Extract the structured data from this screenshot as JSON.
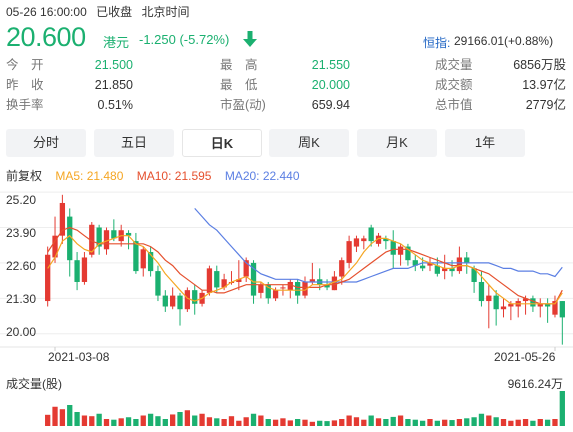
{
  "header": {
    "datetime": "05-26 16:00:00",
    "status": "已收盘",
    "timezone": "北京时间"
  },
  "quote": {
    "price": "20.600",
    "currency": "港元",
    "change": "-1.250 (-5.72%)",
    "index_label": "恒指:",
    "index_value": "29166.01(+0.88%)"
  },
  "stats": {
    "open_label": "今　开",
    "open": "21.500",
    "prev_label": "昨　收",
    "prev": "21.850",
    "turnover_label": "换手率",
    "turnover": "0.51%",
    "high_label": "最　高",
    "high": "21.550",
    "low_label": "最　低",
    "low": "20.000",
    "pe_label": "市盈(动)",
    "pe": "659.94",
    "volume_label": "成交量",
    "volume": "6856万股",
    "amount_label": "成交额",
    "amount": "13.97亿",
    "mcap_label": "总市值",
    "mcap": "2779亿"
  },
  "tabs": [
    "分时",
    "五日",
    "日K",
    "周K",
    "月K",
    "1年"
  ],
  "active_tab": "日K",
  "ma": {
    "adjust": "前复权",
    "ma5": "MA5: 21.480",
    "ma10": "MA10: 21.595",
    "ma20": "MA20: 22.440"
  },
  "colors": {
    "up": "#e43a32",
    "down": "#1bb070",
    "ma5": "#f5a623",
    "ma10": "#e5502e",
    "ma20": "#5b7fe3",
    "index": "#2166c4"
  },
  "chart_data": {
    "type": "candlestick",
    "y_ticks": [
      "25.20",
      "23.90",
      "22.60",
      "21.30",
      "20.00"
    ],
    "ylim": [
      19.55,
      25.35
    ],
    "x_start_label": "2021-03-08",
    "x_end_label": "2021-05-26",
    "volume_label": "成交量(股)",
    "volume_max_label": "9616.24万",
    "candles": [
      [
        21.2,
        22.9,
        23.2,
        21.0
      ],
      [
        22.8,
        23.6,
        24.3,
        22.6
      ],
      [
        23.6,
        24.8,
        25.1,
        23.3
      ],
      [
        24.3,
        22.7,
        24.6,
        22.1
      ],
      [
        22.7,
        21.9,
        23.0,
        21.6
      ],
      [
        21.9,
        22.8,
        23.0,
        21.8
      ],
      [
        22.9,
        24.0,
        24.1,
        22.8
      ],
      [
        23.9,
        23.2,
        24.0,
        22.9
      ],
      [
        23.1,
        23.8,
        23.9,
        22.9
      ],
      [
        23.8,
        23.5,
        24.2,
        23.4
      ],
      [
        23.4,
        23.8,
        24.0,
        23.2
      ],
      [
        23.7,
        23.6,
        23.8,
        23.1
      ],
      [
        23.4,
        22.3,
        23.7,
        22.2
      ],
      [
        22.4,
        23.1,
        23.2,
        22.1
      ],
      [
        23.0,
        22.3,
        23.2,
        22.1
      ],
      [
        22.3,
        21.4,
        22.5,
        21.2
      ],
      [
        21.4,
        21.0,
        21.6,
        20.8
      ],
      [
        21.0,
        21.4,
        21.7,
        20.9
      ],
      [
        21.4,
        20.9,
        21.5,
        20.3
      ],
      [
        20.9,
        21.6,
        21.7,
        20.8
      ],
      [
        21.6,
        21.1,
        21.8,
        20.7
      ],
      [
        21.1,
        21.5,
        21.6,
        21.0
      ],
      [
        21.5,
        22.4,
        22.5,
        21.4
      ],
      [
        22.3,
        21.7,
        22.5,
        21.5
      ],
      [
        21.7,
        22.0,
        22.2,
        21.6
      ],
      [
        21.9,
        21.9,
        22.3,
        21.8
      ],
      [
        21.9,
        22.0,
        22.7,
        21.6
      ],
      [
        22.1,
        22.7,
        22.8,
        21.9
      ],
      [
        22.6,
        21.4,
        22.7,
        21.1
      ],
      [
        21.5,
        21.8,
        21.9,
        21.3
      ],
      [
        21.8,
        21.3,
        21.9,
        21.1
      ],
      [
        21.3,
        21.6,
        21.7,
        21.2
      ],
      [
        21.7,
        21.7,
        21.8,
        21.4
      ],
      [
        21.6,
        21.9,
        22.0,
        21.3
      ],
      [
        21.9,
        21.4,
        22.0,
        21.1
      ],
      [
        21.4,
        21.9,
        22.1,
        21.3
      ],
      [
        21.9,
        22.0,
        22.6,
        21.8
      ],
      [
        22.0,
        21.8,
        22.4,
        21.6
      ],
      [
        21.8,
        21.7,
        22.0,
        21.6
      ],
      [
        21.6,
        22.1,
        22.3,
        21.6
      ],
      [
        22.1,
        22.7,
        22.8,
        21.8
      ],
      [
        22.6,
        23.4,
        23.6,
        22.4
      ],
      [
        23.2,
        23.5,
        23.6,
        23.0
      ],
      [
        23.4,
        23.5,
        23.6,
        23.1
      ],
      [
        23.9,
        23.4,
        24.0,
        23.2
      ],
      [
        23.3,
        23.6,
        23.7,
        23.2
      ],
      [
        23.5,
        23.4,
        23.6,
        23.1
      ],
      [
        23.4,
        22.9,
        23.8,
        22.4
      ],
      [
        22.9,
        23.2,
        23.3,
        22.5
      ],
      [
        23.2,
        22.7,
        23.3,
        22.5
      ],
      [
        22.7,
        22.5,
        22.9,
        22.3
      ],
      [
        22.5,
        22.4,
        22.8,
        22.3
      ],
      [
        22.5,
        22.6,
        22.8,
        22.3
      ],
      [
        22.5,
        22.2,
        22.8,
        22.1
      ],
      [
        22.3,
        22.4,
        22.9,
        22.0
      ],
      [
        22.4,
        22.3,
        22.7,
        22.1
      ],
      [
        22.3,
        22.8,
        23.2,
        22.2
      ],
      [
        22.8,
        22.6,
        23.0,
        22.2
      ],
      [
        22.4,
        21.9,
        22.5,
        21.5
      ],
      [
        21.9,
        21.2,
        22.3,
        21.0
      ],
      [
        21.2,
        21.4,
        21.8,
        20.2
      ],
      [
        21.4,
        20.9,
        21.6,
        20.3
      ],
      [
        20.9,
        21.0,
        21.3,
        20.6
      ],
      [
        21.0,
        21.1,
        21.2,
        20.5
      ],
      [
        21.0,
        21.2,
        21.3,
        20.6
      ],
      [
        21.2,
        21.3,
        21.4,
        20.7
      ],
      [
        21.3,
        21.0,
        21.4,
        20.8
      ],
      [
        21.0,
        21.1,
        21.3,
        20.6
      ],
      [
        21.1,
        21.0,
        21.3,
        20.4
      ],
      [
        20.7,
        21.2,
        21.4,
        20.6
      ],
      [
        21.2,
        20.6,
        21.2,
        19.6
      ]
    ],
    "volumes": [
      0.32,
      0.55,
      0.48,
      0.6,
      0.4,
      0.3,
      0.28,
      0.35,
      0.2,
      0.18,
      0.22,
      0.25,
      0.2,
      0.3,
      0.35,
      0.28,
      0.2,
      0.33,
      0.4,
      0.45,
      0.3,
      0.35,
      0.25,
      0.22,
      0.2,
      0.28,
      0.15,
      0.25,
      0.35,
      0.3,
      0.2,
      0.18,
      0.22,
      0.16,
      0.2,
      0.18,
      0.12,
      0.15,
      0.14,
      0.16,
      0.2,
      0.3,
      0.25,
      0.18,
      0.3,
      0.22,
      0.2,
      0.26,
      0.3,
      0.2,
      0.18,
      0.15,
      0.2,
      0.15,
      0.18,
      0.17,
      0.2,
      0.22,
      0.25,
      0.35,
      0.3,
      0.25,
      0.2,
      0.15,
      0.18,
      0.2,
      0.15,
      0.2,
      0.18,
      0.2,
      1.0
    ],
    "ma5": [
      22.4,
      22.8,
      23.4,
      23.6,
      23.3,
      23.1,
      23.0,
      23.3,
      23.4,
      23.5,
      23.6,
      23.6,
      23.3,
      23.2,
      22.9,
      22.6,
      22.2,
      21.9,
      21.6,
      21.3,
      21.2,
      21.3,
      21.5,
      21.6,
      21.7,
      21.9,
      22.0,
      22.1,
      21.9,
      21.9,
      21.7,
      21.6,
      21.6,
      21.6,
      21.6,
      21.6,
      21.8,
      21.8,
      21.8,
      21.9,
      22.0,
      22.3,
      22.6,
      23.0,
      23.3,
      23.5,
      23.5,
      23.4,
      23.3,
      23.1,
      22.9,
      22.7,
      22.6,
      22.5,
      22.4,
      22.4,
      22.5,
      22.5,
      22.4,
      22.1,
      21.8,
      21.5,
      21.3,
      21.1,
      21.1,
      21.1,
      21.1,
      21.1,
      21.1,
      21.1,
      21.5
    ],
    "ma10": [
      23.0,
      23.4,
      23.8,
      23.9,
      23.8,
      23.6,
      23.4,
      23.3,
      23.3,
      23.3,
      23.3,
      23.3,
      23.3,
      23.3,
      23.2,
      23.0,
      22.7,
      22.5,
      22.2,
      22.0,
      21.8,
      21.6,
      21.6,
      21.5,
      21.5,
      21.6,
      21.7,
      21.8,
      21.8,
      21.8,
      21.8,
      21.8,
      21.8,
      21.8,
      21.7,
      21.7,
      21.7,
      21.7,
      21.8,
      21.8,
      21.9,
      22.0,
      22.2,
      22.4,
      22.6,
      22.8,
      23.0,
      23.1,
      23.1,
      23.1,
      23.0,
      22.9,
      22.8,
      22.7,
      22.6,
      22.5,
      22.5,
      22.5,
      22.4,
      22.3,
      22.2,
      22.0,
      21.8,
      21.6,
      21.4,
      21.3,
      21.2,
      21.1,
      21.1,
      21.1,
      21.6
    ],
    "ma20": [
      null,
      null,
      null,
      null,
      null,
      null,
      null,
      null,
      null,
      null,
      null,
      null,
      null,
      null,
      null,
      null,
      null,
      null,
      null,
      null,
      24.6,
      24.3,
      24.0,
      23.8,
      23.5,
      23.2,
      22.9,
      22.6,
      22.4,
      22.2,
      22.1,
      22.0,
      22.0,
      22.0,
      22.0,
      21.9,
      21.9,
      21.9,
      21.9,
      21.9,
      21.9,
      21.9,
      21.9,
      22.0,
      22.1,
      22.2,
      22.3,
      22.4,
      22.4,
      22.4,
      22.5,
      22.6,
      22.6,
      22.6,
      22.6,
      22.6,
      22.6,
      22.6,
      22.6,
      22.6,
      22.6,
      22.5,
      22.4,
      22.4,
      22.3,
      22.3,
      22.3,
      22.2,
      22.2,
      22.1,
      22.44
    ]
  }
}
